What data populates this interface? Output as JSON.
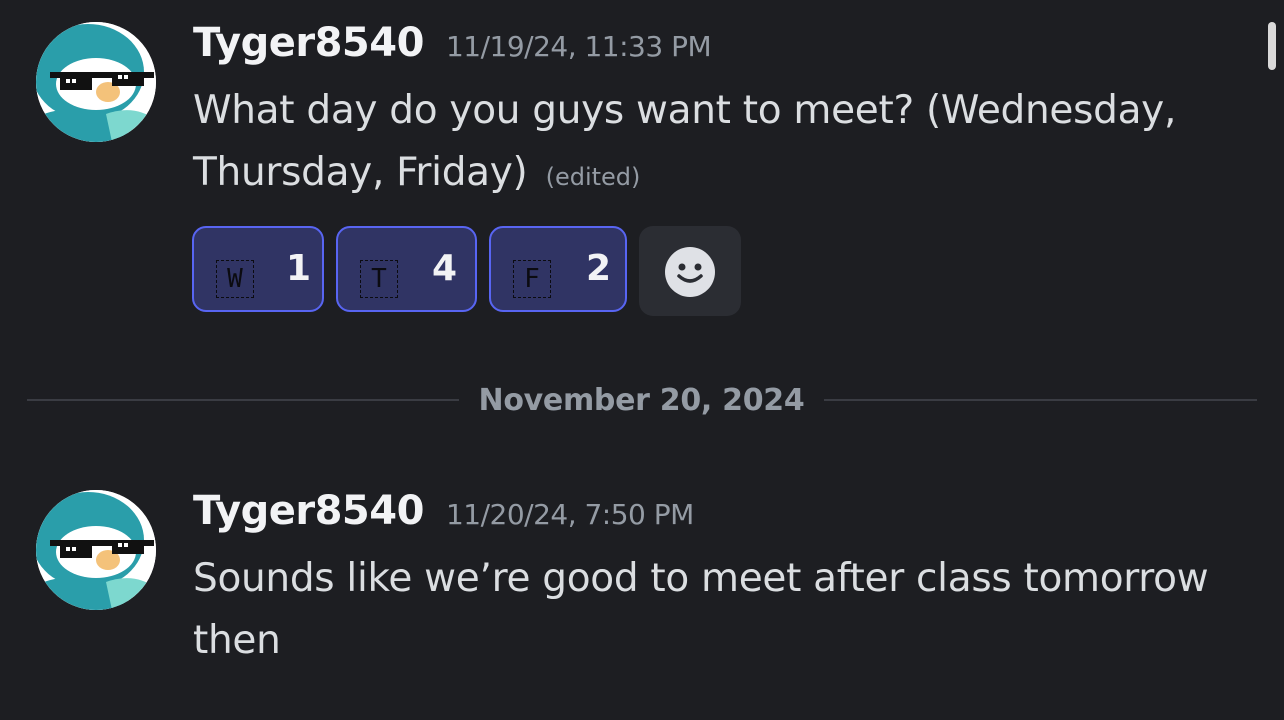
{
  "messages": [
    {
      "username": "Tyger8540",
      "timestamp": "11/19/24, 11:33 PM",
      "text": "What day do you guys want to meet? (Wednesday, Thursday, Friday)",
      "edited_label": "(edited)",
      "avatar_icon": "penguin-sunglasses-avatar-icon",
      "reactions": [
        {
          "emoji_glyph": "W",
          "emoji_icon": "regional-indicator-w-icon",
          "count": "1"
        },
        {
          "emoji_glyph": "T",
          "emoji_icon": "regional-indicator-t-icon",
          "count": "4"
        },
        {
          "emoji_glyph": "F",
          "emoji_icon": "regional-indicator-f-icon",
          "count": "2"
        }
      ],
      "add_reaction_icon": "add-reaction-smiley-icon"
    },
    {
      "username": "Tyger8540",
      "timestamp": "11/20/24, 7:50 PM",
      "text": "Sounds like we’re good to meet after class tomorrow then",
      "avatar_icon": "penguin-sunglasses-avatar-icon"
    }
  ],
  "date_divider": {
    "label": "November 20, 2024"
  },
  "colors": {
    "background": "#1d1e22",
    "reaction_active_bg": "#303464",
    "reaction_active_border": "#5865f2",
    "username": "#f2f3f5",
    "timestamp": "#949ba4",
    "body_text": "#dbdee1"
  }
}
